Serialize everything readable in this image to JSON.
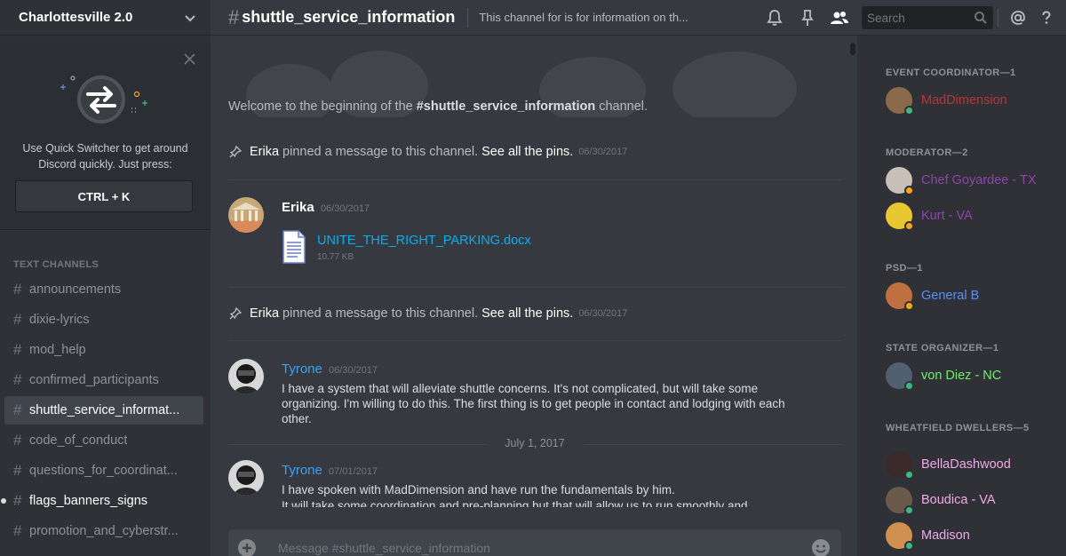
{
  "server": {
    "name": "Charlottesville 2.0"
  },
  "quick_switcher": {
    "text": "Use Quick Switcher to get around Discord quickly. Just press:",
    "shortcut": "CTRL + K"
  },
  "channels": {
    "header": "TEXT CHANNELS",
    "items": [
      {
        "name": "announcements",
        "state": "normal"
      },
      {
        "name": "dixie-lyrics",
        "state": "normal"
      },
      {
        "name": "mod_help",
        "state": "normal"
      },
      {
        "name": "confirmed_participants",
        "state": "normal"
      },
      {
        "name": "shuttle_service_informat...",
        "state": "active"
      },
      {
        "name": "code_of_conduct",
        "state": "normal"
      },
      {
        "name": "questions_for_coordinat...",
        "state": "normal"
      },
      {
        "name": "flags_banners_signs",
        "state": "unread"
      },
      {
        "name": "promotion_and_cyberstr...",
        "state": "normal"
      }
    ]
  },
  "topbar": {
    "hash": "#",
    "channel": "shuttle_service_information",
    "topic": "This channel for is for information on th...",
    "search_placeholder": "Search"
  },
  "chat": {
    "welcome_prefix": "Welcome to the beginning of the ",
    "welcome_channel": "#shuttle_service_information",
    "welcome_suffix": " channel.",
    "pins": [
      {
        "who": "Erika",
        "text": "pinned a message to this channel.",
        "link": "See all the pins.",
        "date": "06/30/2017"
      },
      {
        "who": "Erika",
        "text": "pinned a message to this channel.",
        "link": "See all the pins.",
        "date": "06/30/2017"
      }
    ],
    "messages": [
      {
        "author": "Erika",
        "author_color": "#ffffff",
        "timestamp": "06/30/2017",
        "attachment": {
          "name": "UNITE_THE_RIGHT_PARKING.docx",
          "size": "10.77 KB"
        }
      },
      {
        "author": "Tyrone",
        "author_color": "#3ea3f2",
        "timestamp": "06/30/2017",
        "text": "I have a system that will alleviate shuttle concerns. It's not complicated, but will take some organizing. I'm willing to do this. The first thing is to get people in contact and lodging with each other."
      },
      {
        "author": "Tyrone",
        "author_color": "#3ea3f2",
        "timestamp": "07/01/2017",
        "text": "I have spoken with MadDimension and have run the fundamentals by him.",
        "text2": "It will take some coordination and pre-planning but that will allow us to run smoothly and"
      }
    ],
    "date_divider": "July 1, 2017",
    "composer_placeholder": "Message #shuttle_service_information"
  },
  "members": {
    "groups": [
      {
        "role": "EVENT COORDINATOR—1",
        "members": [
          {
            "name": "MadDimension",
            "color": "#b9343a",
            "status": "online"
          }
        ]
      },
      {
        "role": "MODERATOR—2",
        "members": [
          {
            "name": "Chef Goyardee - TX",
            "color": "#8e44ad",
            "status": "idle"
          },
          {
            "name": "Kurt - VA",
            "color": "#8e44ad",
            "status": "idle"
          }
        ]
      },
      {
        "role": "PSD—1",
        "members": [
          {
            "name": "General B",
            "color": "#5b8ef7",
            "status": "idle"
          }
        ]
      },
      {
        "role": "STATE ORGANIZER—1",
        "members": [
          {
            "name": "von Diez - NC",
            "color": "#6ef06e",
            "status": "online"
          }
        ]
      },
      {
        "role": "WHEATFIELD DWELLERS—5",
        "members": [
          {
            "name": "BellaDashwood",
            "color": "#f3a8e8",
            "status": "online"
          },
          {
            "name": "Boudica - VA",
            "color": "#f3a8e8",
            "status": "online"
          },
          {
            "name": "Madison",
            "color": "#f3a8e8",
            "status": "online"
          }
        ]
      }
    ]
  },
  "colors": {
    "online": "#43b581",
    "idle": "#faa61a",
    "link": "#00b0f4"
  }
}
